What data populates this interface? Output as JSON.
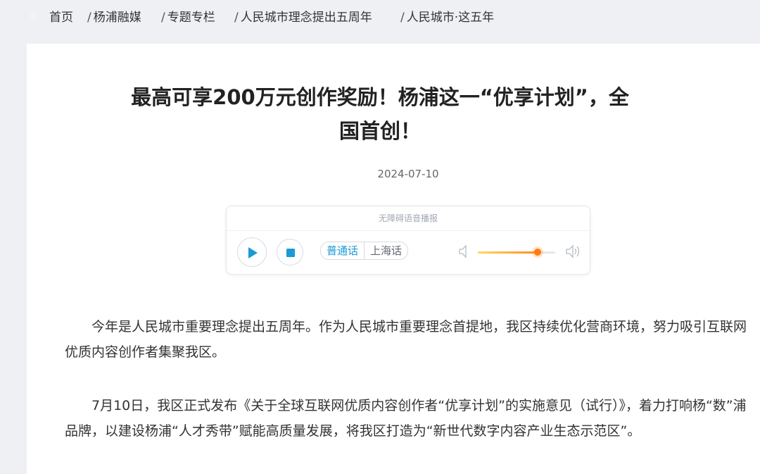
{
  "breadcrumb": {
    "items": [
      "首页",
      "杨浦融媒",
      "专题专栏",
      "人民城市理念提出五周年",
      "人民城市·这五年"
    ],
    "separator": "/"
  },
  "article": {
    "title_line1": "最高可享200万元创作奖励！杨浦这一“优享计划”，全",
    "title_line2": "国首创！",
    "date": "2024-07-10",
    "paragraphs": [
      "今年是人民城市重要理念提出五周年。作为人民城市重要理念首提地，我区持续优化营商环境，努力吸引互联网优质内容创作者集聚我区。",
      "7月10日，我区正式发布《关于全球互联网优质内容创作者“优享计划”的实施意见（试行）》，着力打响杨“数”浦品牌，以建设杨浦“人才秀带”赋能高质量发展，将我区打造为“新世代数字内容产业生态示范区”。"
    ]
  },
  "player": {
    "header": "无障碍语音播报",
    "languages": [
      "普通话",
      "上海话"
    ],
    "active_language": "普通话",
    "volume": 0.77,
    "icons": {
      "play": "play-icon",
      "stop": "stop-icon",
      "volume_low": "volume-low-icon",
      "volume_high": "volume-high-icon"
    }
  },
  "colors": {
    "accent": "#1a9ad6",
    "volume_knob": "#ff7a10",
    "background": "#eef0f4"
  }
}
